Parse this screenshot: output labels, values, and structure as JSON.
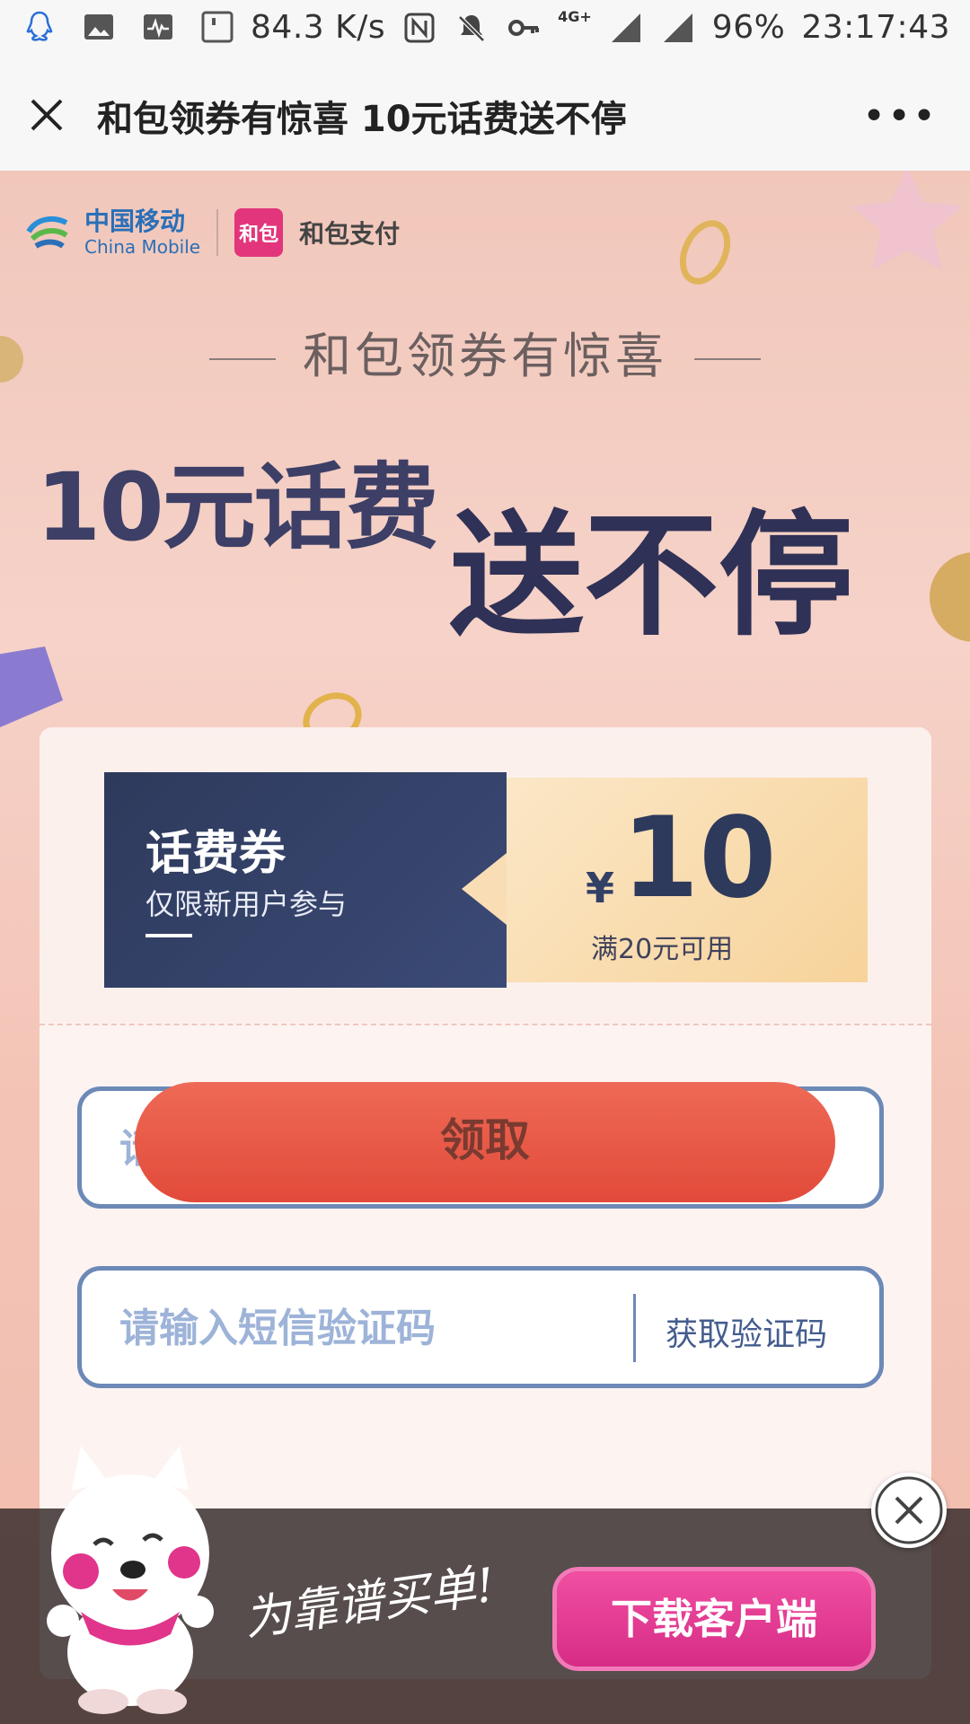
{
  "status_bar": {
    "speed": "84.3 K/s",
    "network": "4G+",
    "battery": "96%",
    "time": "23:17:43"
  },
  "title_bar": {
    "title": "和包领券有惊喜 10元话费送不停",
    "more_label": "•••"
  },
  "brand": {
    "cm_cn": "中国移动",
    "cm_en": "China Mobile",
    "hb_badge": "和包",
    "hb_name": "和包支付"
  },
  "hero": {
    "subtitle": "和包领券有惊喜",
    "headline_a": "10元话费",
    "headline_b": "送不停"
  },
  "coupon": {
    "title": "话费券",
    "subtitle": "仅限新用户参与",
    "currency": "¥",
    "amount": "10",
    "condition": "满20元可用"
  },
  "form": {
    "phone_placeholder": "请输入手机号码",
    "code_placeholder": "请输入短信验证码",
    "get_code": "获取验证码",
    "submit": "领取"
  },
  "ad": {
    "slogan": "为靠谱买单!",
    "download": "下载客户端"
  },
  "colors": {
    "accent_blue": "#2e3a5c",
    "input_border": "#6c89b7",
    "download_pink": "#e2357b",
    "claim_red": "#e24a3a"
  }
}
